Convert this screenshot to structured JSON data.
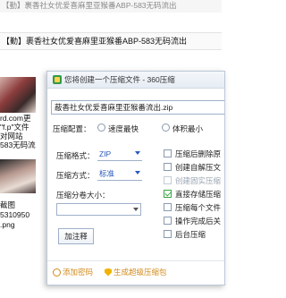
{
  "background": {
    "title": "【勤】裹香社女优爱喜麻里亚猴番ABP-583无码流出",
    "header": "【勤】裹香社女优爱喜麻里亚猴番ABP-583无码流出",
    "side_text_1": [
      "rd.com更",
      "\"f.p\"文件",
      "对网站",
      "583无码流"
    ],
    "side_text_2": [
      "截图",
      "5310950",
      ".png"
    ]
  },
  "dialog": {
    "title": "您将创建一个压缩文件 - 360压缩",
    "filename": "蔽香社女优爱喜麻里亚猴番流出.zip",
    "compression_config": {
      "label": "压缩配置：",
      "options": [
        {
          "label": "速度最快",
          "checked": false
        },
        {
          "label": "体积最小",
          "checked": false
        }
      ]
    },
    "format": {
      "label": "压缩格式：",
      "value": "ZIP"
    },
    "method": {
      "label": "压缩方式：",
      "value": "标准"
    },
    "split": {
      "label": "压缩分卷大小：",
      "value": ""
    },
    "comment_button": "加注释",
    "checkboxes": [
      {
        "label": "压缩后删除原",
        "checked": false
      },
      {
        "label": "创建自解压文",
        "checked": false
      },
      {
        "label": "创建固实压缩",
        "checked": false
      },
      {
        "label": "直接存储压缩",
        "checked": true
      },
      {
        "label": "压缩每个文件",
        "checked": false
      },
      {
        "label": "操作完成后关",
        "checked": false
      },
      {
        "label": "后台压缩",
        "checked": false
      }
    ],
    "footer": {
      "add_password": "添加密码",
      "create_super": "生成超级压缩包"
    }
  }
}
